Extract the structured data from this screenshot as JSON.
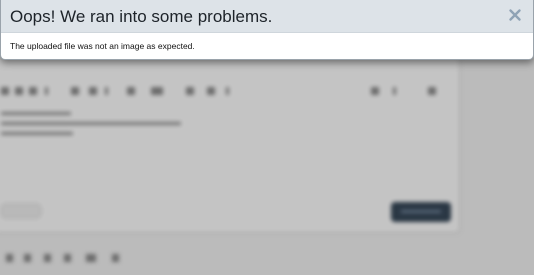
{
  "dialog": {
    "title": "Oops! We ran into some problems.",
    "message": "The uploaded file was not an image as expected.",
    "close_icon": "close-icon",
    "colors": {
      "header_bg": "#dde3e8",
      "title_text": "#1d2329",
      "close_icon": "#8fa3b5",
      "body_bg": "#ffffff"
    }
  },
  "background": {
    "state": "blurred",
    "primary_button_color": "#1f2e3d"
  }
}
